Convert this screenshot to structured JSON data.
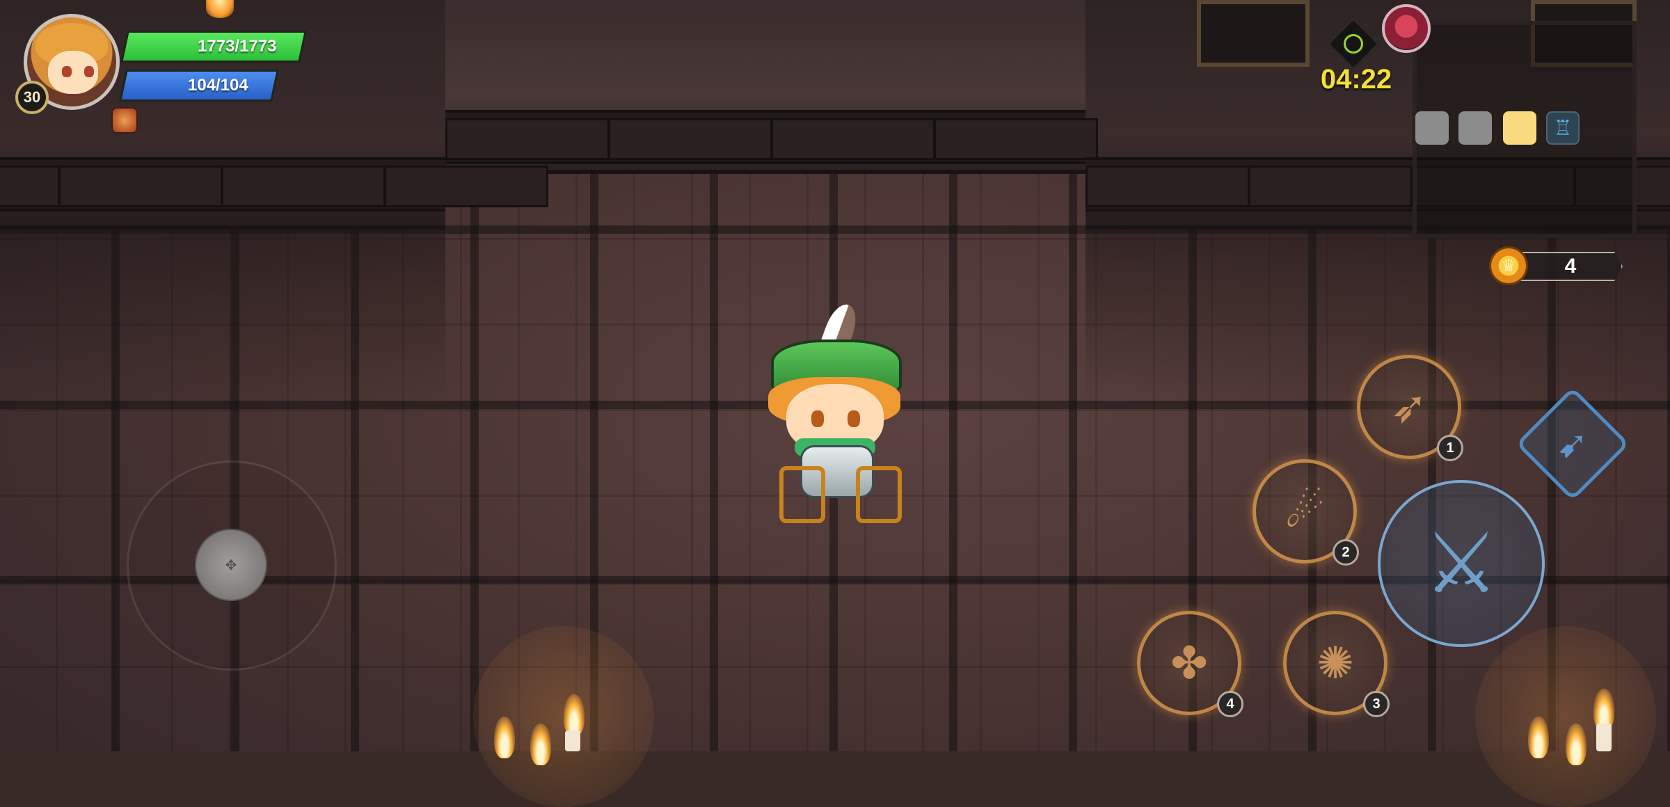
{
  "player": {
    "level": "30",
    "hp_text": "1773/1773",
    "mp_text": "104/104",
    "hp_fraction": 1.0,
    "mp_fraction": 1.0
  },
  "stage": {
    "timer": "04:22"
  },
  "currency": {
    "crown_count": "4"
  },
  "item_slots": [
    {
      "state": "empty",
      "color": "#8c8c8c"
    },
    {
      "state": "empty",
      "color": "#8c8c8c"
    },
    {
      "state": "filled",
      "color": "#f9dc7e"
    },
    {
      "state": "icon",
      "icon": "blue-trophy-icon",
      "color": "#58b6e8"
    }
  ],
  "skills": [
    {
      "slot": "1",
      "icon": "archer-volley-icon"
    },
    {
      "slot": "2",
      "icon": "meteor-icon"
    },
    {
      "slot": "3",
      "icon": "spiral-burst-icon"
    },
    {
      "slot": "4",
      "icon": "fairy-summon-icon"
    }
  ],
  "controls": {
    "attack_icon": "sword-icon",
    "dash_icon": "dash-icon",
    "joystick_icon": "dpad-icon"
  },
  "colors": {
    "hp": "#2cbf3a",
    "mp": "#2860c9",
    "timer": "#f2e232",
    "skill_ring": "#dd9c4d",
    "attack_ring": "#7aa7cf"
  }
}
